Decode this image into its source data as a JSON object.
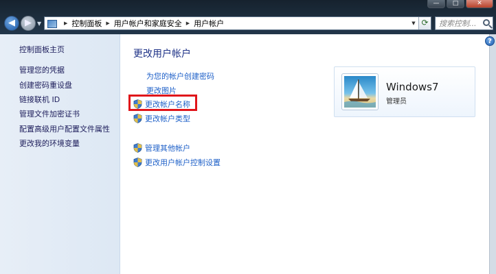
{
  "window": {
    "minimize": "—",
    "maximize": "□",
    "close": "✕"
  },
  "nav": {
    "back": "◀",
    "forward": "▶"
  },
  "address": {
    "crumbs": [
      "控制面板",
      "用户帐户和家庭安全",
      "用户帐户"
    ]
  },
  "search": {
    "placeholder": "搜索控制..."
  },
  "sidebar": {
    "items": [
      {
        "label": "控制面板主页"
      },
      {
        "label": "管理您的凭据"
      },
      {
        "label": "创建密码重设盘"
      },
      {
        "label": "链接联机 ID"
      },
      {
        "label": "管理文件加密证书"
      },
      {
        "label": "配置高级用户配置文件属性"
      },
      {
        "label": "更改我的环境变量"
      }
    ]
  },
  "main": {
    "title": "更改用户帐户",
    "links": [
      {
        "label": "为您的帐户创建密码"
      },
      {
        "label": "更改图片"
      },
      {
        "label": "更改帐户名称"
      },
      {
        "label": "更改帐户类型"
      }
    ],
    "other_links": [
      {
        "label": "管理其他帐户"
      },
      {
        "label": "更改用户帐户控制设置"
      }
    ]
  },
  "user": {
    "name": "Windows7",
    "role": "管理员"
  },
  "help": "?",
  "colors": {
    "highlight_border": "#e0141a",
    "link": "#1e60c8",
    "title": "#1e3287"
  }
}
